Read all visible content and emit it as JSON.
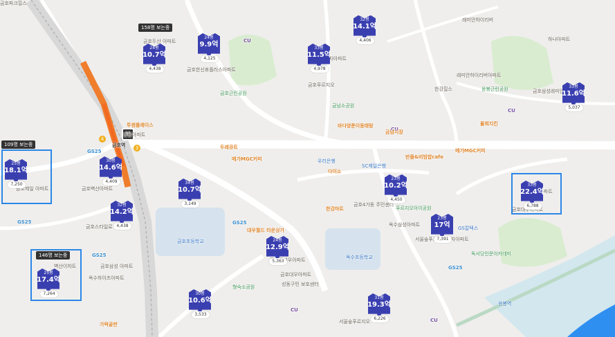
{
  "markers": [
    {
      "area": "24평",
      "price": "10.7억",
      "count": "4,438"
    },
    {
      "area": "24평",
      "price": "9.9억",
      "count": "4,125"
    },
    {
      "area": "32평",
      "price": "14.1억",
      "count": "4,406"
    },
    {
      "area": "33평",
      "price": "11.5억",
      "count": "4,978"
    },
    {
      "area": "33평",
      "price": "11.6억",
      "count": "5,037"
    },
    {
      "area": "25평",
      "price": "18.1억",
      "count": "7,250"
    },
    {
      "area": "30평",
      "price": "14.6억",
      "count": "4,409"
    },
    {
      "area": "34평",
      "price": "10.7억",
      "count": "3,149"
    },
    {
      "area": "32평",
      "price": "14.2억",
      "count": "4,438"
    },
    {
      "area": "23평",
      "price": "10.2억",
      "count": "4,450"
    },
    {
      "area": "33평",
      "price": "22.4억",
      "count": "6,788"
    },
    {
      "area": "23평",
      "price": "17억",
      "count": "7,391"
    },
    {
      "area": "24평",
      "price": "12.9억",
      "count": "5,363"
    },
    {
      "area": "25평",
      "price": "17.4억",
      "count": "7,264"
    },
    {
      "area": "30평",
      "price": "10.6억",
      "count": "3,533"
    },
    {
      "area": "31평",
      "price": "19.3억",
      "count": "6,226"
    }
  ],
  "view_tags": [
    "158명 보는중",
    "109명 보는중",
    "146명 보는중"
  ],
  "station": {
    "symbol": "地",
    "label": "금호역",
    "lines": [
      "4",
      "3"
    ]
  },
  "pois": [
    {
      "text": "CU",
      "kind": "cu"
    },
    {
      "text": "CU",
      "kind": "cu"
    },
    {
      "text": "CU",
      "kind": "cu"
    },
    {
      "text": "CU",
      "kind": "cu"
    },
    {
      "text": "CU",
      "kind": "cu"
    },
    {
      "text": "GS25",
      "kind": "gs"
    },
    {
      "text": "GS25",
      "kind": "gs"
    },
    {
      "text": "GS25",
      "kind": "gs"
    },
    {
      "text": "GS25",
      "kind": "gs"
    },
    {
      "text": "GS25",
      "kind": "gs"
    },
    {
      "text": "금호두산 아파트",
      "kind": ""
    },
    {
      "text": "금호벽산아파트",
      "kind": ""
    },
    {
      "text": "금호한신휴플러스아파트",
      "kind": ""
    },
    {
      "text": "래미안하이리버",
      "kind": ""
    },
    {
      "text": "래미안하이리버아파트",
      "kind": ""
    },
    {
      "text": "금호삼성래미안아파트",
      "kind": ""
    },
    {
      "text": "금호자이2차아파트",
      "kind": ""
    },
    {
      "text": "금호푸르지오",
      "kind": ""
    },
    {
      "text": "한강힐스",
      "kind": ""
    },
    {
      "text": "금호근린공원",
      "kind": "green"
    },
    {
      "text": "금남소공원",
      "kind": "green"
    },
    {
      "text": "금남시장",
      "kind": "orange"
    },
    {
      "text": "바다양푼이동태탕",
      "kind": "orange"
    },
    {
      "text": "물회지킨",
      "kind": "orange"
    },
    {
      "text": "메가MGC커피",
      "kind": "orange"
    },
    {
      "text": "메가MGC커피",
      "kind": "orange"
    },
    {
      "text": "두레큐트",
      "kind": "orange"
    },
    {
      "text": "투썸플레이스",
      "kind": "orange"
    },
    {
      "text": "우리은행",
      "kind": "blue"
    },
    {
      "text": "SC제일은행",
      "kind": "blue"
    },
    {
      "text": "다이소",
      "kind": "orange"
    },
    {
      "text": "반줄&비빔밥cafe",
      "kind": "orange"
    },
    {
      "text": "한강마트",
      "kind": "orange"
    },
    {
      "text": "금호4가동 주민센터",
      "kind": ""
    },
    {
      "text": "푸르지오아이공원",
      "kind": "green"
    },
    {
      "text": "GS칼텍스",
      "kind": "blue"
    },
    {
      "text": "금호초등학교",
      "kind": "blue"
    },
    {
      "text": "대우월드 타운상가",
      "kind": "orange"
    },
    {
      "text": "금호동대우아파트",
      "kind": ""
    },
    {
      "text": "옥수초등학교",
      "kind": "blue"
    },
    {
      "text": "서울숲푸르지오 2차아파트",
      "kind": ""
    },
    {
      "text": "옥수삼성아파트",
      "kind": ""
    },
    {
      "text": "독서당인문아카데미",
      "kind": "green"
    },
    {
      "text": "응봉근린공원",
      "kind": "green"
    },
    {
      "text": "금호제일 아파트",
      "kind": ""
    },
    {
      "text": "형숙소공원",
      "kind": "green"
    },
    {
      "text": "금호대우아파트",
      "kind": ""
    },
    {
      "text": "금호삼성 아파트",
      "kind": ""
    },
    {
      "text": "성동구민 보호센터",
      "kind": ""
    },
    {
      "text": "서울숲푸르지오",
      "kind": ""
    },
    {
      "text": "옥수하이츠아파트",
      "kind": ""
    },
    {
      "text": "가락골판",
      "kind": "orange"
    },
    {
      "text": "응봉역",
      "kind": "blue"
    },
    {
      "text": "하나아파트",
      "kind": ""
    },
    {
      "text": "금호대우아파트",
      "kind": ""
    },
    {
      "text": "라이브아파트",
      "kind": ""
    },
    {
      "text": "벽산이하트",
      "kind": ""
    },
    {
      "text": "금호스타일로",
      "kind": ""
    },
    {
      "text": "동원아파트",
      "kind": ""
    },
    {
      "text": "금호파크힐스",
      "kind": ""
    }
  ]
}
